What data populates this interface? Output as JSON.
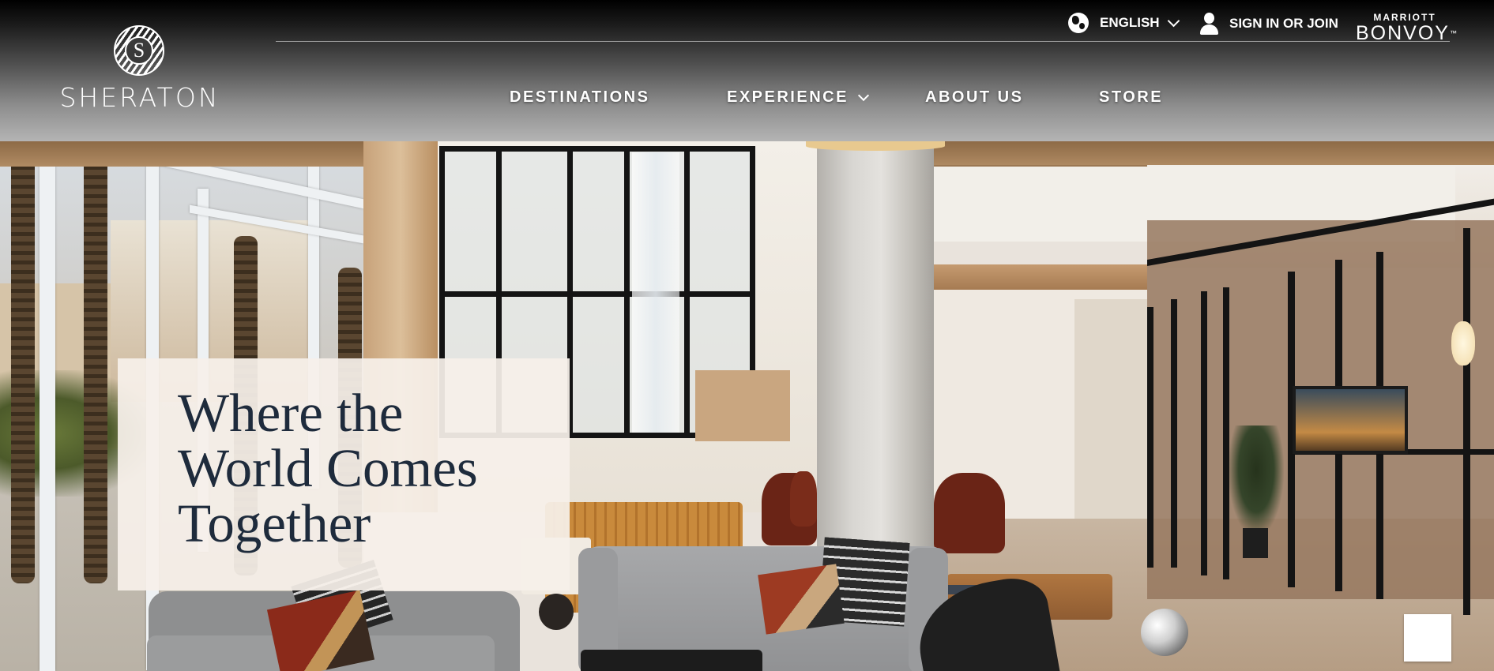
{
  "brand": {
    "logo_text": "SHERATON",
    "logo_monogram": "S"
  },
  "utility": {
    "language_label": "ENGLISH",
    "sign_in_label": "SIGN IN OR JOIN",
    "partner_top": "MARRIOTT",
    "partner_bottom": "BONVOY",
    "partner_mark": "™"
  },
  "nav": {
    "items": [
      {
        "label": "DESTINATIONS"
      },
      {
        "label": "EXPERIENCE",
        "has_dropdown": true
      },
      {
        "label": "ABOUT US"
      },
      {
        "label": "STORE"
      }
    ]
  },
  "hero": {
    "headline": "Where the World Comes Together"
  },
  "icons": {
    "language": "globe-icon",
    "language_dropdown": "chevron-down-icon",
    "account": "user-icon",
    "experience_dropdown": "chevron-down-icon"
  },
  "colors": {
    "headline_text": "#1e2b3c",
    "card_background": "#f6f0e9",
    "header_text": "#ffffff"
  }
}
